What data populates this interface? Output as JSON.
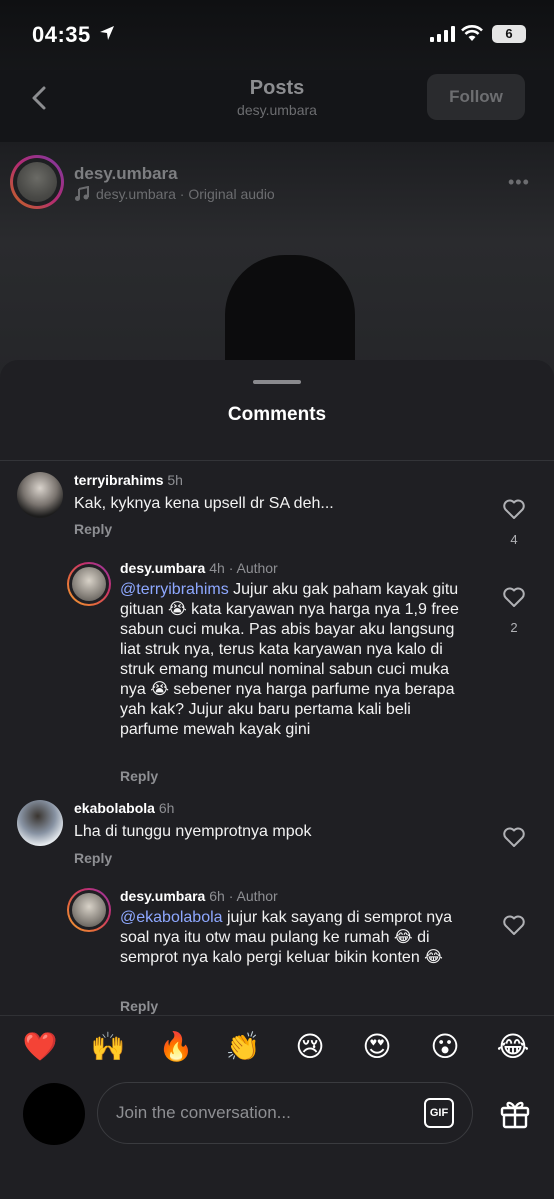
{
  "status_bar": {
    "time": "04:35",
    "battery": "6"
  },
  "nav": {
    "title": "Posts",
    "subtitle": "desy.umbara",
    "follow_label": "Follow"
  },
  "post": {
    "username": "desy.umbara",
    "audio": "desy.umbara · Original audio"
  },
  "comments_sheet": {
    "title": "Comments",
    "comments": [
      {
        "username": "terryibrahims",
        "time": "5h",
        "text": "Kak, kyknya kena upsell dr SA deh...",
        "reply_label": "Reply",
        "likes": "4"
      },
      {
        "username": "desy.umbara",
        "time": "4h · Author",
        "mention": "@terryibrahims",
        "text": " Jujur aku gak paham kayak gitu gituan 😭 kata karyawan nya harga nya 1,9 free sabun cuci muka. Pas abis bayar aku langsung liat struk nya, terus kata karyawan nya kalo di struk emang muncul nominal sabun cuci muka nya 😭 sebener nya harga parfume nya berapa yah kak? Jujur aku baru pertama kali beli parfume mewah kayak gini",
        "reply_label": "Reply",
        "likes": "2"
      },
      {
        "username": "ekabolabola",
        "time": "6h",
        "text": "Lha di tunggu nyemprotnya mpok",
        "reply_label": "Reply"
      },
      {
        "username": "desy.umbara",
        "time": "6h · Author",
        "mention": "@ekabolabola",
        "text": " jujur kak sayang di semprot nya soal nya itu otw mau pulang ke rumah 😂 di semprot nya kalo pergi keluar bikin konten 😂",
        "reply_label": "Reply"
      }
    ]
  },
  "reactions": [
    "❤️",
    "🙌",
    "🔥",
    "👏",
    "😢",
    "😍",
    "😮",
    "😂"
  ],
  "composer": {
    "placeholder": "Join the conversation...",
    "gif_label": "GIF"
  }
}
